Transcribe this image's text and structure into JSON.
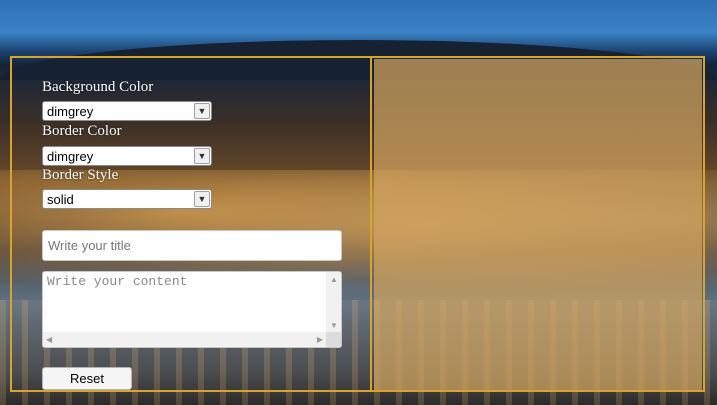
{
  "form": {
    "background_color": {
      "label": "Background Color",
      "value": "dimgrey"
    },
    "border_color": {
      "label": "Border Color",
      "value": "dimgrey"
    },
    "border_style": {
      "label": "Border Style",
      "value": "solid"
    },
    "title_placeholder": "Write your title",
    "content_placeholder": "Write your content",
    "reset_label": "Reset"
  },
  "icons": {
    "dropdown": "chevron-down-icon",
    "scroll_up": "triangle-up-icon",
    "scroll_down": "triangle-down-icon",
    "scroll_left": "triangle-left-icon",
    "scroll_right": "triangle-right-icon"
  },
  "colors": {
    "panel_border": "#d9a42a",
    "preview_fill": "#d2a55f"
  }
}
